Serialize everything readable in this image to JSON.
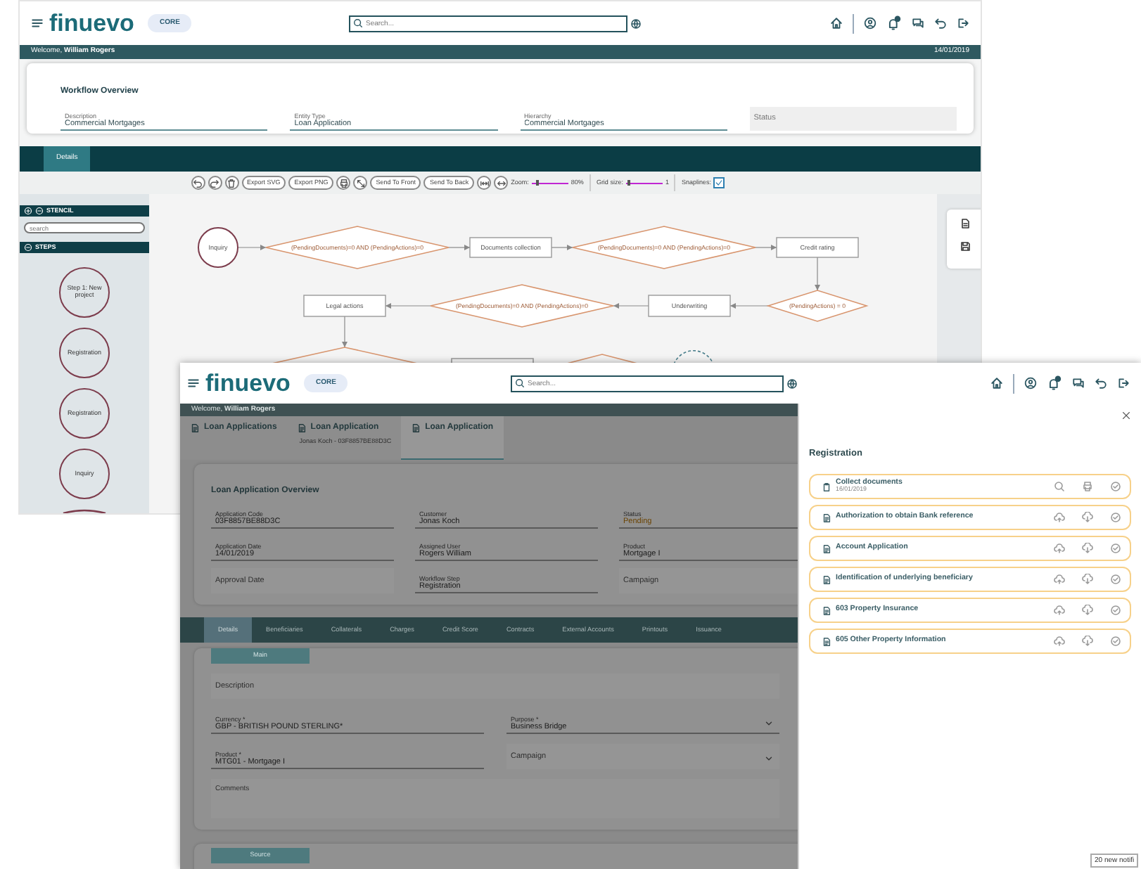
{
  "workflow_window": {
    "header": {
      "logo": "finuevo",
      "badge": "CORE",
      "search": {
        "placeholder": "Search..."
      }
    },
    "welcome": "Welcome, **William Rogers**",
    "date": "14/01/2019",
    "overview": {
      "title": "Workflow Overview",
      "fields": [
        {
          "label": "Description",
          "value": "Commercial Mortgages"
        },
        {
          "label": "Entity Type",
          "value": "Loan Application"
        },
        {
          "label": "Hierarchy",
          "value": "Commercial Mortgages"
        },
        {
          "placeholder": "Status"
        }
      ]
    },
    "tabs": [
      {
        "label": "Details",
        "selected": true
      }
    ],
    "toolbar": {
      "buttons": [
        "Export SVG",
        "Export PNG",
        "Send To Front",
        "Send To Back"
      ],
      "zoom": {
        "label": "Zoom:",
        "level": 0.1,
        "reading": "80%"
      },
      "grid": {
        "label": "Grid size:",
        "level": 0.05,
        "reading": "1"
      },
      "snaplines": {
        "label": "Snaplines:",
        "checked": true
      }
    },
    "stencil": {
      "title": "STENCIL",
      "search": {
        "placeholder": "search"
      },
      "section": "STEPS",
      "steps": [
        "Step 1: New project",
        "Registration",
        "Registration",
        "Inquiry"
      ]
    },
    "diagram": {
      "nodes": [
        {
          "kind": "circle",
          "label": "Inquiry"
        },
        {
          "kind": "diamond",
          "label": "(PendingDocuments)=0 AND (PendingActions)=0"
        },
        {
          "kind": "rect",
          "label": "Documents collection"
        },
        {
          "kind": "diamond",
          "label": "(PendingDocuments)=0 AND (PendingActions)=0"
        },
        {
          "kind": "rect",
          "label": "Credit rating"
        },
        {
          "kind": "rect",
          "label": "Legal actions"
        },
        {
          "kind": "diamond",
          "label": "(PendingDocuments)=0 AND (PendingActions)=0"
        },
        {
          "kind": "rect",
          "label": "Underwriting"
        },
        {
          "kind": "diamond",
          "label": "(PendingActions) = 0"
        }
      ]
    }
  },
  "loan_window": {
    "header": {
      "logo": "finuevo",
      "badge": "CORE",
      "search": {
        "placeholder": "Search..."
      }
    },
    "welcome": "Welcome, **William Rogers**",
    "tabs": [
      {
        "title": "Loan Applications",
        "selected": false
      },
      {
        "title": "Loan Application",
        "subtitle": "Jonas Koch - 03F8857BE88D3C",
        "selected": false
      },
      {
        "title": "Loan Application",
        "selected": true
      }
    ],
    "overview": {
      "title": "Loan Application Overview",
      "fields": [
        {
          "label": "Application Code",
          "value": "03F8857BE88D3C"
        },
        {
          "label": "Customer",
          "value": "Jonas Koch"
        },
        {
          "label": "Status",
          "value": "Pending",
          "color": "#6b4300"
        },
        {
          "label": "Application Date",
          "value": "14/01/2019"
        },
        {
          "label": "Assigned User",
          "value": "Rogers William"
        },
        {
          "label": "Product",
          "value": "Mortgage I"
        },
        {
          "placeholder": "Approval Date"
        },
        {
          "label": "Workflow Step",
          "value": "Registration"
        },
        {
          "placeholder": "Campaign"
        }
      ]
    },
    "section_tabs": [
      {
        "label": "Details",
        "selected": true
      },
      {
        "label": "Beneficiaries",
        "selected": false
      },
      {
        "label": "Collaterals",
        "selected": false
      },
      {
        "label": "Charges",
        "selected": false
      },
      {
        "label": "Credit Score",
        "selected": false
      },
      {
        "label": "Contracts",
        "selected": false
      },
      {
        "label": "External Accounts",
        "selected": false
      },
      {
        "label": "Printouts",
        "selected": false
      },
      {
        "label": "Issuance",
        "selected": false
      }
    ],
    "main": {
      "title": "Main",
      "fields": [
        {
          "kind": "text",
          "placeholder": "Description"
        },
        {
          "kind": "text",
          "label": "Currency *",
          "value": "GBP - BRITISH POUND STERLING*"
        },
        {
          "kind": "select",
          "label": "Purpose *",
          "value": "Business Bridge"
        },
        {
          "kind": "text",
          "label": "Product *",
          "value": "MTG01 - Mortgage I"
        },
        {
          "kind": "select",
          "placeholder": "Campaign"
        },
        {
          "kind": "textarea",
          "placeholder": "Comments"
        }
      ]
    },
    "source": {
      "title": "Source"
    },
    "panel": {
      "title": "Registration",
      "items": [
        {
          "kind": "task",
          "title": "Collect documents",
          "date": "16/01/2019"
        },
        {
          "kind": "document",
          "title": "Authorization to obtain Bank reference"
        },
        {
          "kind": "document",
          "title": "Account Application"
        },
        {
          "kind": "document",
          "title": "Identification of underlying beneficiary"
        },
        {
          "kind": "document",
          "title": "603 Property Insurance"
        },
        {
          "kind": "document",
          "title": "605 Other Property Information"
        }
      ]
    },
    "toast": "20 new notifi"
  }
}
